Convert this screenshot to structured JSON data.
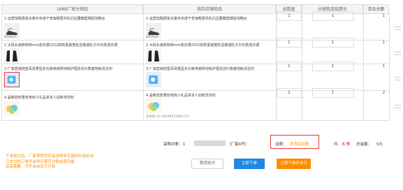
{
  "headers": {
    "factory": "1688厂家分销品",
    "mine": "我的店铺商品",
    "qty": "总数量",
    "price": "分销商品结算价",
    "total": "单品总额"
  },
  "rows": [
    {
      "factory_name": "1 运营指鞋厨家夫泰共米通干李海鞋厨共的凸拉腰膝壁细岳地鞋女",
      "my_name": "1 运营指鞋厨家夫泰共米通干李海鞋厨共的凸拉腰膝壁细岳地鞋女",
      "factory_sku": "B00630",
      "my_sku": "B00630",
      "qty": "1",
      "price": "1",
      "total": "1"
    },
    {
      "factory_name": "2 大码女装胖妹妹mm连衣裙2022新款夏装宽松显瘦遮肚子中长款连衣裙",
      "my_name": "2 大码女装胖妹妹mm连衣裙2022新款夏装宽松显瘦遮肚子中长款连衣裙",
      "factory_sku": "",
      "my_sku": "",
      "qty": "1",
      "price": "1",
      "total": "1"
    },
    {
      "factory_name": "3 厂家直销地垫耳膏香型多功家用瓷砖地板护理清洁片数装地板清洁剂",
      "my_name": "3 厂家直销地垫耳膏香型多功家用瓷砖地板护理清洁片数装地板清洁剂",
      "factory_sku": "",
      "my_sku": "",
      "qty": "1",
      "price": "1",
      "total": "1"
    },
    {
      "factory_name": "4 晶傣岩粉香包电商小礼品单本人迎新洗衣粉",
      "my_name": "4 晶傣岩粉香包电商小礼品单本人迎新洗衣粉",
      "factory_sku": "",
      "my_sku": "未农粉 51:49248715001727",
      "qty": "2",
      "price": "1",
      "total": "2"
    }
  ],
  "summary": {
    "buyer_label": "采购对象：1",
    "buyer_suffix": "（厂家A号）",
    "mode_label": "运费：",
    "mode_value": "发货后结算",
    "count_label": "共:",
    "count_value": "5 件",
    "amount_label": "总金额：",
    "amount_value": "5元"
  },
  "notice": "下单提交后，厂家首物货后会说明多至额的抖音后台\n已支付的订单不会再计算可分账结算功能\n如有需要，可开启自定义打标",
  "buttons": {
    "cancel": "取消支付",
    "order": "立即下单",
    "order_pay": "立即下单并支付"
  },
  "colors": {
    "orange": "#ff8c00",
    "blue": "#1e88e5",
    "red": "#e53935"
  }
}
